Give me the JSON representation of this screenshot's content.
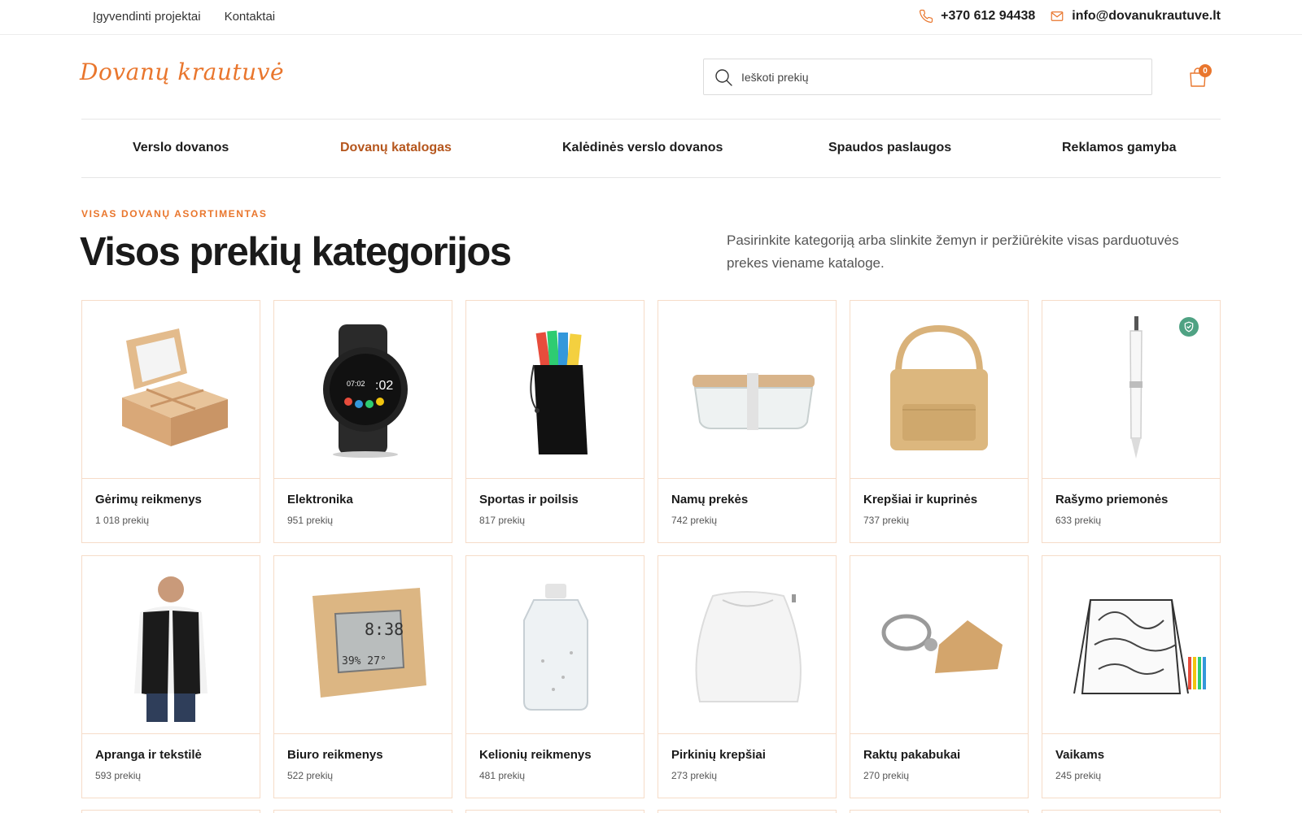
{
  "topbar": {
    "links": [
      "Įgyvendinti projektai",
      "Kontaktai"
    ],
    "phone": "+370 612 94438",
    "email": "info@dovanukrautuve.lt"
  },
  "header": {
    "logo_text": "Dovanų krautuvė",
    "search_placeholder": "Ieškoti prekių",
    "cart_count": "0"
  },
  "nav": {
    "items": [
      {
        "label": "Verslo dovanos",
        "active": false
      },
      {
        "label": "Dovanų katalogas",
        "active": true
      },
      {
        "label": "Kalėdinės verslo dovanos",
        "active": false
      },
      {
        "label": "Spaudos paslaugos",
        "active": false
      },
      {
        "label": "Reklamos gamyba",
        "active": false
      }
    ]
  },
  "hero": {
    "eyebrow": "VISAS DOVANŲ ASORTIMENTAS",
    "title": "Visos prekių kategorijos",
    "description": "Pasirinkite kategoriją arba slinkite žemyn ir peržiūrėkite visas parduotuvės prekes viename kataloge."
  },
  "categories": [
    {
      "name": "Gėrimų reikmenys",
      "count": "1 018 prekių",
      "icon": "tea-box-icon"
    },
    {
      "name": "Elektronika",
      "count": "951 prekių",
      "icon": "smartwatch-icon"
    },
    {
      "name": "Sportas ir poilsis",
      "count": "817 prekių",
      "icon": "resistance-bands-pouch-icon"
    },
    {
      "name": "Namų prekės",
      "count": "742 prekių",
      "icon": "lunch-box-icon"
    },
    {
      "name": "Krepšiai ir kuprinės",
      "count": "737 prekių",
      "icon": "cooler-bag-icon"
    },
    {
      "name": "Rašymo priemonės",
      "count": "633 prekių",
      "icon": "pen-icon",
      "eco_badge": "eco-shield-icon"
    },
    {
      "name": "Apranga ir tekstilė",
      "count": "593 prekių",
      "icon": "vest-person-icon"
    },
    {
      "name": "Biuro reikmenys",
      "count": "522 prekių",
      "icon": "weather-station-icon"
    },
    {
      "name": "Kelionių reikmenys",
      "count": "481 prekių",
      "icon": "sanitizer-bottle-icon"
    },
    {
      "name": "Pirkinių krepšiai",
      "count": "273 prekių",
      "icon": "drawstring-bag-icon"
    },
    {
      "name": "Raktų pakabukai",
      "count": "270 prekių",
      "icon": "house-keychain-icon"
    },
    {
      "name": "Vaikams",
      "count": "245 prekių",
      "icon": "coloring-backpack-icon"
    }
  ],
  "colors": {
    "accent": "#e9762d",
    "active_nav": "#b5561d",
    "card_border": "#f6dcc8",
    "eco_badge": "#4fa283"
  }
}
